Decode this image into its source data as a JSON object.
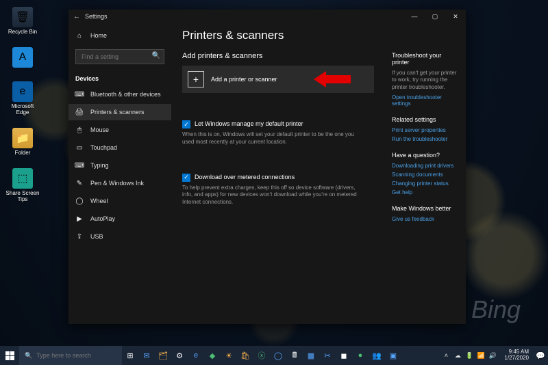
{
  "desktop": {
    "bing_watermark": "Bing",
    "icons": [
      {
        "label": "Recycle Bin"
      },
      {
        "label": ""
      },
      {
        "label": "Microsoft Edge"
      },
      {
        "label": "Folder"
      },
      {
        "label": "Share Screen Tips"
      }
    ]
  },
  "window": {
    "title": "Settings",
    "back_glyph": "←",
    "min": "—",
    "max": "▢",
    "close": "✕"
  },
  "sidebar": {
    "home": "Home",
    "search_placeholder": "Find a setting",
    "group": "Devices",
    "items": [
      {
        "icon": "⌨",
        "label": "Bluetooth & other devices"
      },
      {
        "icon": "🖨",
        "label": "Printers & scanners"
      },
      {
        "icon": "🖱",
        "label": "Mouse"
      },
      {
        "icon": "▭",
        "label": "Touchpad"
      },
      {
        "icon": "⌨",
        "label": "Typing"
      },
      {
        "icon": "✎",
        "label": "Pen & Windows Ink"
      },
      {
        "icon": "◯",
        "label": "Wheel"
      },
      {
        "icon": "▶",
        "label": "AutoPlay"
      },
      {
        "icon": "⇪",
        "label": "USB"
      }
    ]
  },
  "content": {
    "page_title": "Printers & scanners",
    "section_add": "Add printers & scanners",
    "add_button": "Add a printer or scanner",
    "default_check": "Let Windows manage my default printer",
    "default_desc": "When this is on, Windows will set your default printer to be the one you used most recently at your current location.",
    "metered_check": "Download over metered connections",
    "metered_desc": "To help prevent extra charges, keep this off so device software (drivers, info, and apps) for new devices won't download while you're on metered Internet connections."
  },
  "rail": {
    "troubleshoot": {
      "title": "Troubleshoot your printer",
      "desc": "If you can't get your printer to work, try running the printer troubleshooter.",
      "link": "Open troubleshooter settings"
    },
    "related": {
      "title": "Related settings",
      "links": [
        "Print server properties",
        "Run the troubleshooter"
      ]
    },
    "question": {
      "title": "Have a question?",
      "links": [
        "Downloading print drivers",
        "Scanning documents",
        "Changing printer status",
        "Get help"
      ]
    },
    "better": {
      "title": "Make Windows better",
      "link": "Give us feedback"
    }
  },
  "taskbar": {
    "search_placeholder": "Type here to search",
    "time": "9:45 AM",
    "date": "1/27/2020"
  }
}
